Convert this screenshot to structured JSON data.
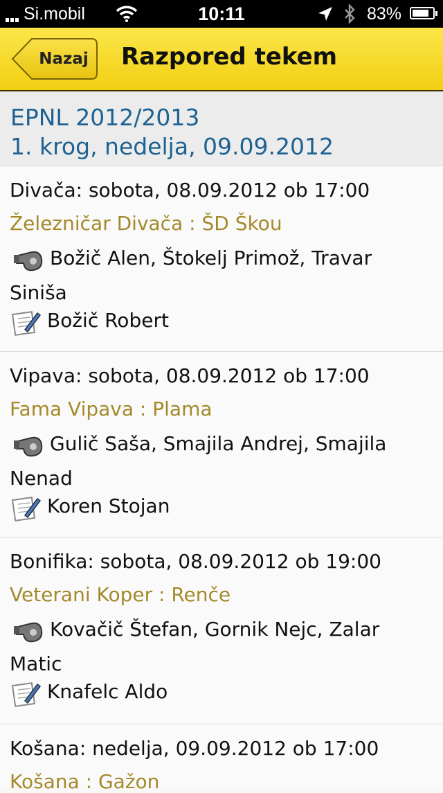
{
  "status": {
    "carrier": "Si.mobil",
    "time": "10:11",
    "battery": "83%",
    "battery_level": 0.83
  },
  "nav": {
    "back_label": "Nazaj",
    "title": "Razpored tekem"
  },
  "header": {
    "line1": "EPNL 2012/2013",
    "line2": "1. krog, nedelja, 09.09.2012"
  },
  "matches": [
    {
      "venue": "Divača: sobota, 08.09.2012 ob 17:00",
      "teams": "Železničar Divača : ŠD Škou",
      "referees_line1": "Božič Alen, Štokelj Primož, Travar",
      "referees_line2": "Siniša",
      "delegate": "Božič Robert"
    },
    {
      "venue": "Vipava: sobota, 08.09.2012 ob 17:00",
      "teams": "Fama Vipava : Plama",
      "referees_line1": "Gulič Saša, Smajila Andrej, Smajila",
      "referees_line2": "Nenad",
      "delegate": "Koren Stojan"
    },
    {
      "venue": "Bonifika: sobota, 08.09.2012 ob 19:00",
      "teams": "Veterani Koper : Renče",
      "referees_line1": "Kovačič Štefan, Gornik Nejc, Zalar",
      "referees_line2": "Matic",
      "delegate": "Knafelc Aldo"
    },
    {
      "venue": "Košana: nedelja, 09.09.2012 ob 17:00",
      "teams": "Košana : Gažon"
    }
  ]
}
